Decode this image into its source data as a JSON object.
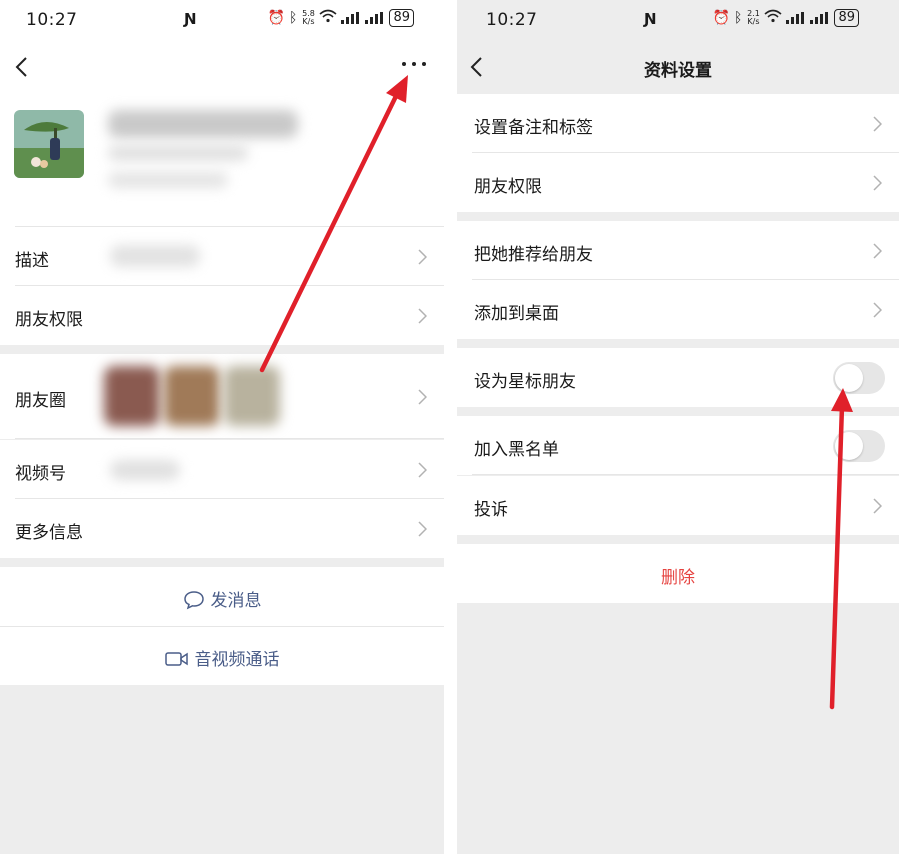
{
  "left": {
    "status": {
      "time": "10:27",
      "speed_top": "5.8",
      "speed_bottom": "K/s",
      "battery": "89"
    },
    "rows": [
      {
        "label": "描述"
      },
      {
        "label": "朋友权限"
      },
      {
        "label": "朋友圈"
      },
      {
        "label": "视频号"
      },
      {
        "label": "更多信息"
      }
    ],
    "actions": {
      "message": "发消息",
      "call": "音视频通话"
    }
  },
  "right": {
    "status": {
      "time": "10:27",
      "speed_top": "2.1",
      "speed_bottom": "K/s",
      "battery": "89"
    },
    "title": "资料设置",
    "rows": [
      {
        "label": "设置备注和标签"
      },
      {
        "label": "朋友权限"
      },
      {
        "label": "把她推荐给朋友"
      },
      {
        "label": "添加到桌面"
      },
      {
        "label": "设为星标朋友",
        "toggle": false
      },
      {
        "label": "加入黑名单",
        "toggle": false
      },
      {
        "label": "投诉"
      }
    ],
    "delete_label": "删除"
  },
  "colors": {
    "accent_link": "#4a5d88",
    "danger": "#e64340",
    "annotation_arrow": "#e0202a"
  }
}
